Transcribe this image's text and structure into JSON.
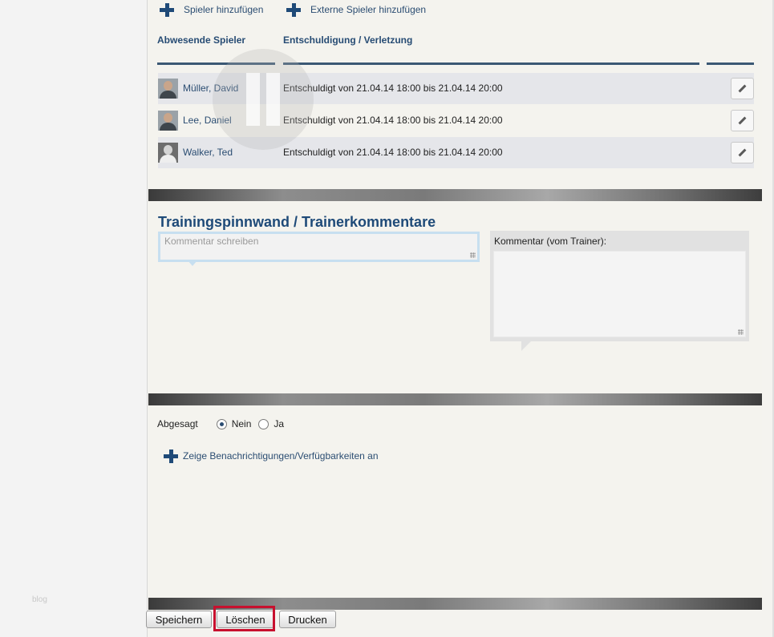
{
  "sidebar": {
    "footer_text": "blog"
  },
  "actions": {
    "add_player": "Spieler hinzufügen",
    "add_external_player": "Externe Spieler hinzufügen"
  },
  "absent_table": {
    "col_player": "Abwesende Spieler",
    "col_excuse": "Entschuldigung / Verletzung",
    "rows": [
      {
        "name": "Müller, David",
        "excuse": "Entschuldigt   von 21.04.14 18:00 bis 21.04.14 20:00"
      },
      {
        "name": "Lee, Daniel",
        "excuse": "Entschuldigt   von 21.04.14 18:00 bis 21.04.14 20:00"
      },
      {
        "name": "Walker, Ted",
        "excuse": "Entschuldigt   von 21.04.14 18:00 bis 21.04.14 20:00"
      }
    ]
  },
  "comments": {
    "title": "Trainingspinnwand / Trainerkommentare",
    "placeholder": "Kommentar schreiben",
    "trainer_label": "Kommentar (vom Trainer):"
  },
  "cancel": {
    "label": "Abgesagt",
    "option_no": "Nein",
    "option_yes": "Ja",
    "selected": "Nein"
  },
  "notifications_link": "Zeige Benachrichtigungen/Verfügbarkeiten an",
  "buttons": {
    "save": "Speichern",
    "delete": "Löschen",
    "print": "Drucken"
  },
  "colors": {
    "link": "#2b4d72",
    "heading": "#1e4a78",
    "highlight": "#c8102e"
  }
}
